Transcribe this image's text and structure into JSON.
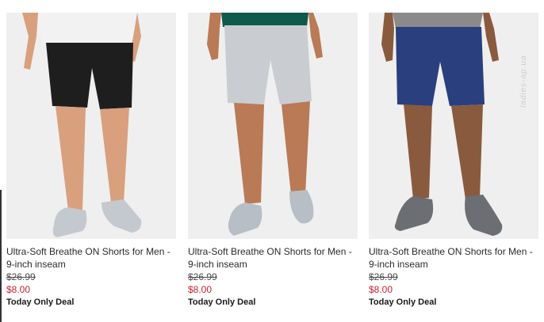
{
  "products": [
    {
      "name": "Ultra-Soft Breathe ON Shorts for Men - 9-inch inseam",
      "original_price": "$26.99",
      "sale_price": "$8.00",
      "deal_label": "Today Only Deal",
      "shirt_color": "#f2f2f2",
      "shorts_color": "#1e1e1e",
      "shoe_color": "#c4c9cf"
    },
    {
      "name": "Ultra-Soft Breathe ON Shorts for Men - 9-inch inseam",
      "original_price": "$26.99",
      "sale_price": "$8.00",
      "deal_label": "Today Only Deal",
      "shirt_color": "#0f5a4a",
      "shorts_color": "#c9cdd1",
      "shoe_color": "#b8bec5"
    },
    {
      "name": "Ultra-Soft Breathe ON Shorts for Men - 9-inch inseam",
      "original_price": "$26.99",
      "sale_price": "$8.00",
      "deal_label": "Today Only Deal",
      "shirt_color": "#8a8a8a",
      "shorts_color": "#2a3f7e",
      "shoe_color": "#6b6e72"
    }
  ],
  "watermark": "ladies-ap.ua"
}
